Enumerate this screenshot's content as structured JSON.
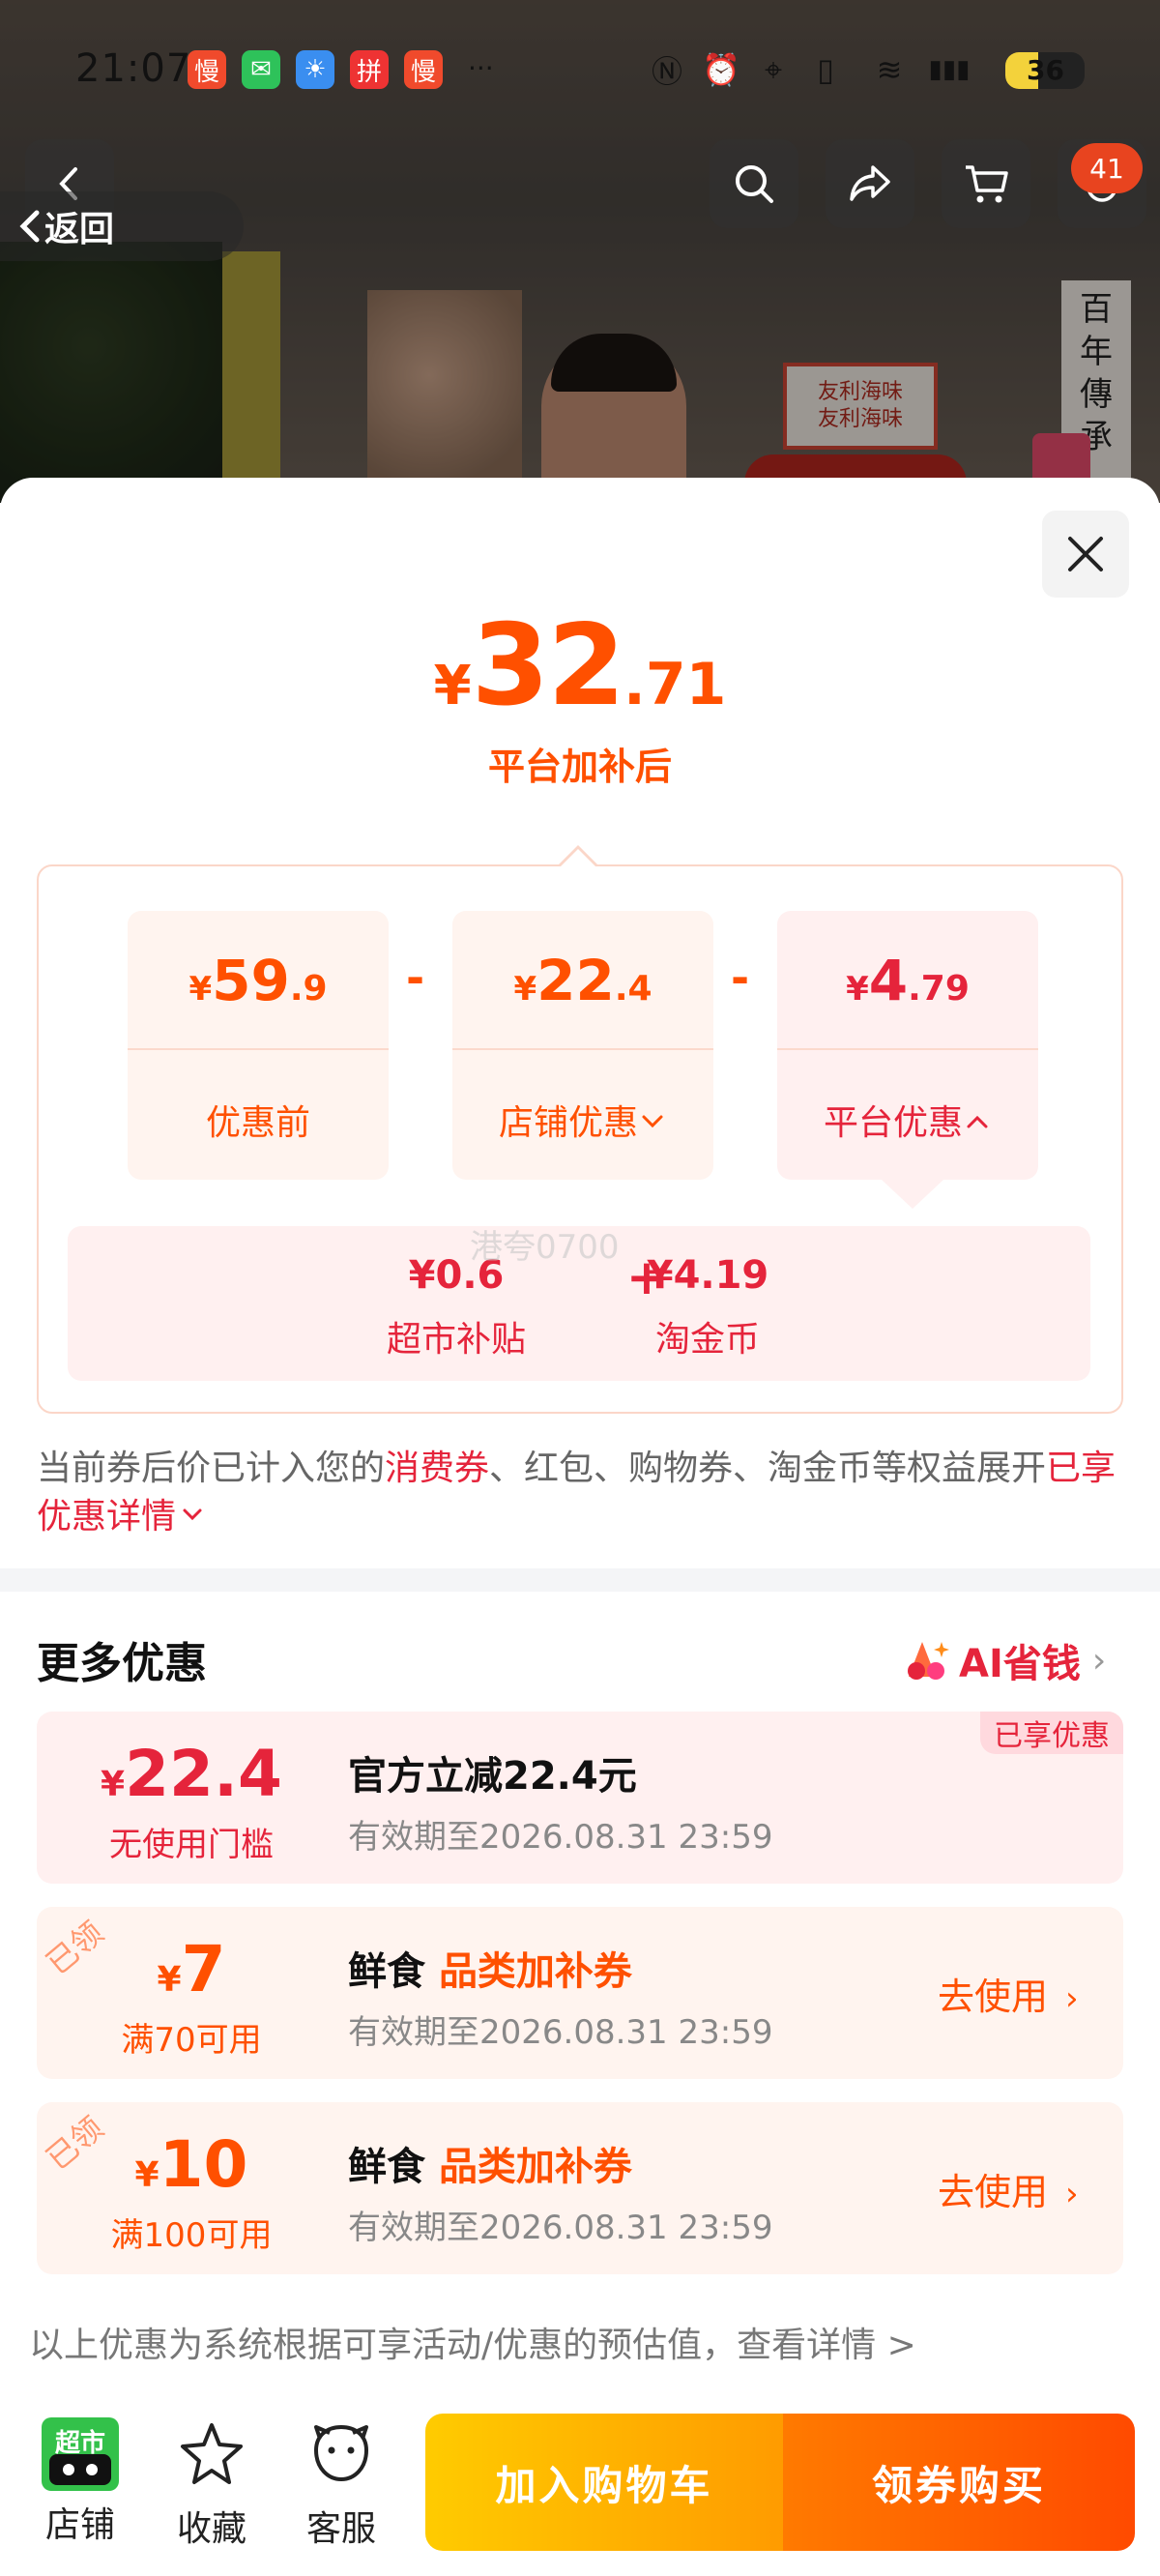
{
  "status_bar": {
    "time": "21:07",
    "notif_icons": [
      {
        "name": "manman-app-icon",
        "glyph": "慢",
        "color": "#f04a2c"
      },
      {
        "name": "wechat-icon",
        "glyph": "✉",
        "color": "#2ec25a"
      },
      {
        "name": "weather-icon",
        "glyph": "☀",
        "color": "#3a8ef0"
      },
      {
        "name": "pdd-app-icon",
        "glyph": "拼",
        "color": "#e33"
      },
      {
        "name": "manman-app-icon-2",
        "glyph": "慢",
        "color": "#f04a2c"
      }
    ],
    "more": "···",
    "battery": "36"
  },
  "nav": {
    "back_label": "返回",
    "cart_badge": "41"
  },
  "backdrop": {
    "sign_lines": [
      "友利海味",
      "友利海味"
    ],
    "banner_chars": [
      "百",
      "年",
      "傳",
      "承"
    ]
  },
  "price": {
    "symbol": "¥",
    "integer": "32",
    "decimal": ".71",
    "subtitle": "平台加补后"
  },
  "breakdown": {
    "items": [
      {
        "symbol": "¥",
        "integer": "59",
        "decimal": ".9",
        "label": "优惠前"
      },
      {
        "symbol": "¥",
        "integer": "22",
        "decimal": ".4",
        "label": "店铺优惠"
      },
      {
        "symbol": "¥",
        "integer": "4",
        "decimal": ".79",
        "label": "平台优惠"
      }
    ],
    "operator": "-",
    "platform_detail": [
      {
        "value": "¥0.6",
        "label": "超市补贴"
      },
      {
        "value": "¥4.19",
        "label": "淘金币"
      }
    ],
    "plus": "+",
    "watermark": "港夸0700"
  },
  "note": {
    "part1": "当前券后价已计入您的",
    "highlight1": "消费券",
    "part2": "、红包、购物券、淘金币等权益展开",
    "highlight2": "已享优惠详情"
  },
  "more": {
    "title": "更多优惠",
    "ai_label": "AI省钱"
  },
  "coupons": [
    {
      "symbol": "¥",
      "amount": "22.4",
      "condition": "无使用门槛",
      "title": "官方立减22.4元",
      "tag": "",
      "expiry": "有效期至2026.08.31 23:59",
      "badge": "已享优惠",
      "action": "",
      "stamp": ""
    },
    {
      "symbol": "¥",
      "amount": "7",
      "condition": "满70可用",
      "title": "鲜食 ",
      "tag": "品类加补券",
      "expiry": "有效期至2026.08.31 23:59",
      "badge": "",
      "action": "去使用",
      "stamp": "已领"
    },
    {
      "symbol": "¥",
      "amount": "10",
      "condition": "满100可用",
      "title": "鲜食 ",
      "tag": "品类加补券",
      "expiry": "有效期至2026.08.31 23:59",
      "badge": "",
      "action": "去使用",
      "stamp": "已领"
    }
  ],
  "footnote": "以上优惠为系统根据可享活动/优惠的预估值，查看详情 >",
  "bottom_bar": {
    "store": "店铺",
    "store_logo": "超市",
    "favorite": "收藏",
    "service": "客服",
    "add_cart": "加入购物车",
    "buy": "领券购买"
  },
  "colors": {
    "accent_orange": "#ff5000",
    "accent_red": "#e5243b"
  }
}
